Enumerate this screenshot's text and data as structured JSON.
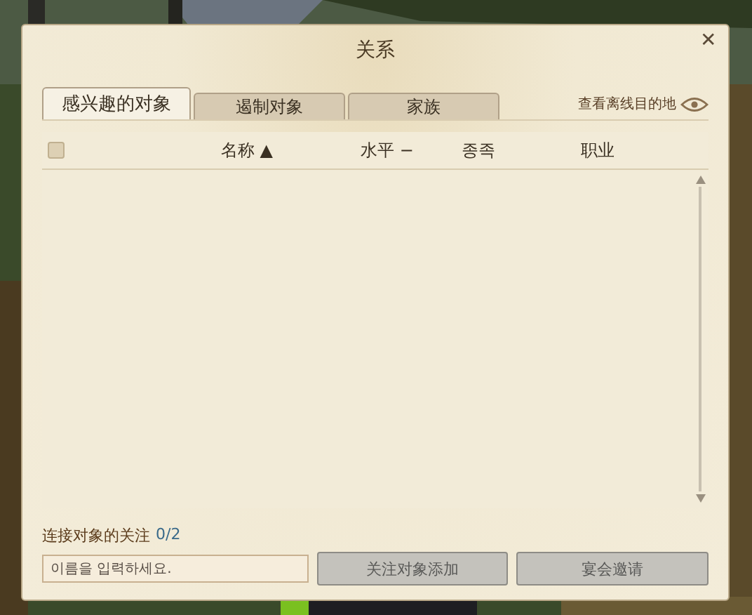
{
  "window": {
    "title": "关系",
    "close": "✕"
  },
  "tabs": [
    {
      "label": "感兴趣的对象",
      "selected": true
    },
    {
      "label": "遏制对象",
      "selected": false
    },
    {
      "label": "家族",
      "selected": false
    }
  ],
  "offline_toggle": {
    "label": "查看离线目的地"
  },
  "table": {
    "select_all": {
      "checked": false
    },
    "columns": [
      {
        "label": "名称",
        "sort": "▲"
      },
      {
        "label": "水平",
        "sort": "−"
      },
      {
        "label": "종족"
      },
      {
        "label": "职业"
      }
    ]
  },
  "footer": {
    "label": "连接对象的关注",
    "count": "0/2",
    "input": {
      "placeholder": "이름을 입력하세요."
    },
    "buttons": [
      {
        "label": "关注对象添加",
        "disabled": true
      },
      {
        "label": "宴会邀请",
        "disabled": true
      }
    ]
  }
}
